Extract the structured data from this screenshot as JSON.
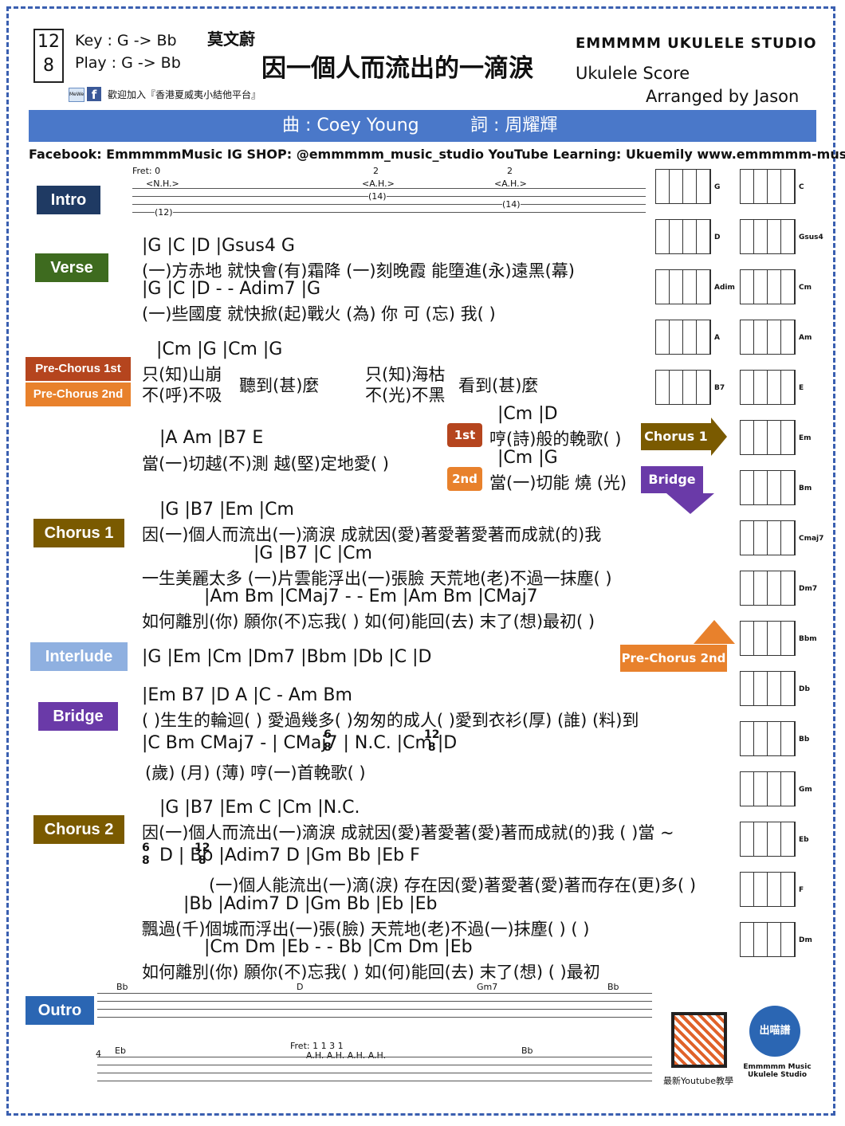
{
  "header": {
    "time_top": "12",
    "time_bottom": "8",
    "key": "Key : G -> Bb",
    "play": "Play : G -> Bb",
    "singer": "莫文蔚",
    "title": "因一個人而流出的一滴淚",
    "join": "歡迎加入『香港夏威夷小結他平台』",
    "studio": "EMMMMM UKULELE STUDIO",
    "score": "Ukulele Score",
    "arranged": "Arranged by Jason"
  },
  "banner": {
    "music": "曲 : Coey Young",
    "lyrics": "詞 : 周耀輝"
  },
  "social": "Facebook: EmmmmmMusic IG SHOP: @emmmmm_music_studio YouTube Learning: Ukuemily  www.emmmmm-music.hk",
  "sections": {
    "intro": "Intro",
    "verse": "Verse",
    "pre1": "Pre-Chorus 1st",
    "pre2": "Pre-Chorus 2nd",
    "chorus1": "Chorus 1",
    "interlude": "Interlude",
    "bridge": "Bridge",
    "chorus2": "Chorus 2",
    "outro": "Outro"
  },
  "intro_tab": {
    "fret0": "Fret: 0",
    "nh": "<N.H.>",
    "ah": "<A.H.>",
    "n2": "2",
    "n12": "(12)",
    "n14": "(14)"
  },
  "verse": {
    "c1": "|G                        |C                  |D                          |Gsus4     G",
    "l1": "(一)方赤地  就快會(有)霜降     (一)刻晚霞  能墮進(永)遠黑(幕)",
    "c2": "|G                        |C                  |D   -    - Adim7  |G",
    "l2": "(一)些國度  就快掀(起)戰火      (為) 你  可   (忘)   我( )"
  },
  "pre": {
    "c1": "|Cm                     |G                    |Cm                      |G",
    "l1a": "只(知)山崩",
    "l1b": "不(呼)不吸",
    "l1c": "聽到(甚)麼",
    "l2a": "只(知)海枯",
    "l2b": "不(光)不黑",
    "l2c": "看到(甚)麼",
    "c3": "|A          Am         |B7              E",
    "l3": "當(一)切越(不)測  越(堅)定地愛( )",
    "end1_c": "|Cm                  |D",
    "end1_l": "哼(詩)般的輓歌( )",
    "end2_c": "|Cm                  |G",
    "end2_l": "當(一)切能 燒 (光)",
    "b1": "1st",
    "b2": "2nd",
    "to_chorus": "Chorus 1",
    "to_bridge": "Bridge"
  },
  "chorus1": {
    "c1": "|G                      |B7                    |Em                      |Cm",
    "l1": "因(一)個人而流出(一)滴淚 成就因(愛)著愛著愛著而成就(的)我",
    "c2": "|G                    |B7                   |C                |Cm",
    "l2": "一生美麗太多 (一)片雲能浮出(一)張臉 天荒地(老)不過一抹塵( )",
    "c3": "|Am          Bm   |CMaj7 -   -  Em         |Am       Bm   |CMaj7",
    "l3": "如何離別(你)  願你(不)忘我( )        如(何)能回(去) 末了(想)最初( )"
  },
  "interlude": {
    "c1": "|G      |Em     |Cm     |Dm7    |Bbm    |Db     |C      |D",
    "to_pre2": "Pre-Chorus 2nd"
  },
  "bridge": {
    "c1": "|Em                  B7        |D                  A                   |C  -   Am  Bm",
    "l1": "( )生生的輪迴( ) 愛過幾多( )匆匆的成人( )愛到衣衫(厚)      (誰)  (料)到",
    "c2": "|C     Bm  CMaj7  -  |   CMaj7  |      N.C.      |Cm         |D",
    "ts1_top": "6",
    "ts1_bot": "8",
    "ts2_top": "12",
    "ts2_bot": "8",
    "l2": "(歲)   (月)   (薄)                                                  哼(一)首輓歌( )"
  },
  "chorus2": {
    "c1": "|G                      |B7                   |Em            C               |Cm     |N.C.",
    "l1": "因(一)個人而流出(一)滴淚  成就因(愛)著愛著(愛)著而成就(的)我    ( )當 ~",
    "c2": "D   |    Bb            |Adim7  D              |Gm               Bb                    |Eb      F",
    "ts1_top": "6",
    "ts1_bot": "8",
    "ts2_top": "12",
    "ts2_bot": "8",
    "l2": "(一)個人能流出(一)滴(淚)  存在因(愛)著愛著(愛)著而存在(更)多( )",
    "c3": "|Bb                |Adim7   D            |Gm        Bb       |Eb                |Eb",
    "l3": "飄過(千)個城而浮出(一)張(臉)  天荒地(老)不過(一)抹塵( )               ( )",
    "c4": "|Cm            Dm       |Eb   -    -  Bb        |Cm          Dm     |Eb",
    "l4": "如何離別(你)  願你(不)忘我( )        如(何)能回(去) 末了(想)      ( )最初"
  },
  "outro": {
    "chords1": [
      "Bb",
      "D",
      "Gm7",
      "Bb"
    ],
    "chords2": [
      "Eb",
      "Bb"
    ],
    "fret": "Fret: 1      1     3          1",
    "ah": "A.H.  A.H.  A.H.       A.H.",
    "m4": "4"
  },
  "diagrams": [
    {
      "l": "G",
      "r": "C"
    },
    {
      "l": "D",
      "r": "Gsus4"
    },
    {
      "l": "Adim",
      "r": "Cm"
    },
    {
      "l": "A",
      "r": "Am"
    },
    {
      "l": "B7",
      "r": "E"
    },
    {
      "l": "",
      "r": "Em"
    },
    {
      "l": "",
      "r": "Bm"
    },
    {
      "l": "",
      "r": "Cmaj7"
    },
    {
      "l": "",
      "r": "Dm7"
    },
    {
      "l": "",
      "r": "Bbm"
    },
    {
      "l": "",
      "r": "Db"
    },
    {
      "l": "",
      "r": "Bb"
    },
    {
      "l": "",
      "r": "Gm"
    },
    {
      "l": "",
      "r": "Eb"
    },
    {
      "l": "",
      "r": "F"
    },
    {
      "l": "",
      "r": "Dm"
    }
  ],
  "footer": {
    "qr_caption": "最新Youtube教學",
    "paw_text": "出喵譜",
    "paw_caption": "Emmmmm Music Ukulele Studio"
  },
  "colors": {
    "navy": "#1f3a63",
    "green": "#3e6b1f",
    "brown": "#7a5a00",
    "orange": "#e8812c",
    "darkred": "#b5451e",
    "lightblue": "#8fb0e0",
    "purple": "#6a3aa8",
    "blue": "#2b66b3"
  }
}
